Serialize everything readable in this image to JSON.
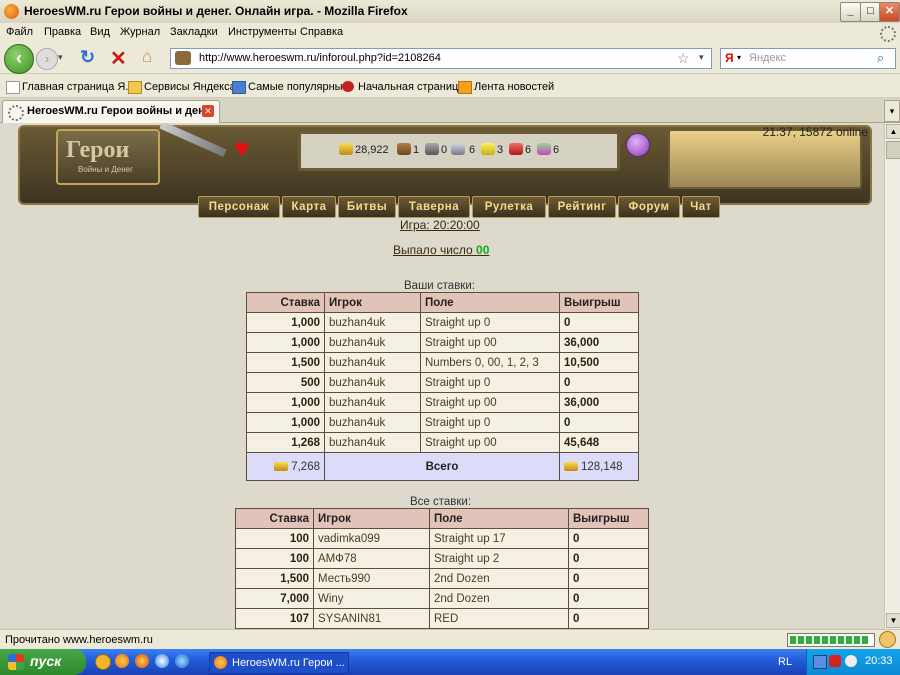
{
  "window": {
    "title": "HeroesWM.ru Герои войны и денег. Онлайн игра. - Mozilla Firefox"
  },
  "menu": [
    "Файл",
    "Правка",
    "Вид",
    "Журнал",
    "Закладки",
    "Инструменты",
    "Справка"
  ],
  "nav": {
    "url": "http://www.heroeswm.ru/inforoul.php?id=2108264",
    "search_engine_label": "Я",
    "search_placeholder": "Яндекс"
  },
  "bookmarks": [
    "Главная страница Я...",
    "Сервисы Яндекса",
    "Самые популярные",
    "Начальная страница",
    "Лента новостей"
  ],
  "tab": {
    "label": "HeroesWM.ru Герои войны и ден..."
  },
  "game": {
    "logo": "Герои",
    "logo_sub": "Войны и Денег",
    "time_online": "21:37, 15872 online",
    "resources": {
      "gold": "28,922",
      "wood": "1",
      "ore": "0",
      "mercury": "6",
      "sulfur": "3",
      "crystals": "6",
      "gems": "6"
    },
    "menu": [
      "Персонаж",
      "Карта",
      "Битвы",
      "Таверна",
      "Рулетка",
      "Рейтинг",
      "Форум",
      "Чат"
    ]
  },
  "roulette": {
    "game_label": "Игра: 20:20:00",
    "result_prefix": "Выпало число ",
    "result_number": "00",
    "your_bets_caption": "Ваши ставки:",
    "all_bets_caption": "Все ставки:",
    "columns": [
      "Ставка",
      "Игрок",
      "Поле",
      "Выигрыш"
    ],
    "your_bets": [
      {
        "bet": "1,000",
        "player": "buzhan4uk",
        "field": "Straight up 0",
        "win": "0"
      },
      {
        "bet": "1,000",
        "player": "buzhan4uk",
        "field": "Straight up 00",
        "win": "36,000"
      },
      {
        "bet": "1,500",
        "player": "buzhan4uk",
        "field": "Numbers 0, 00, 1, 2, 3",
        "win": "10,500"
      },
      {
        "bet": "500",
        "player": "buzhan4uk",
        "field": "Straight up 0",
        "win": "0"
      },
      {
        "bet": "1,000",
        "player": "buzhan4uk",
        "field": "Straight up 00",
        "win": "36,000"
      },
      {
        "bet": "1,000",
        "player": "buzhan4uk",
        "field": "Straight up 0",
        "win": "0"
      },
      {
        "bet": "1,268",
        "player": "buzhan4uk",
        "field": "Straight up 00",
        "win": "45,648"
      }
    ],
    "totals": {
      "bet": "7,268",
      "label": "Всего",
      "win": "128,148"
    },
    "all_bets": [
      {
        "bet": "100",
        "player": "vadimka099",
        "field": "Straight up 17",
        "win": "0"
      },
      {
        "bet": "100",
        "player": "АМФ78",
        "field": "Straight up 2",
        "win": "0"
      },
      {
        "bet": "1,500",
        "player": "Месть990",
        "field": "2nd Dozen",
        "win": "0"
      },
      {
        "bet": "7,000",
        "player": "Winy",
        "field": "2nd Dozen",
        "win": "0"
      },
      {
        "bet": "107",
        "player": "SYSANIN81",
        "field": "RED",
        "win": "0"
      }
    ]
  },
  "status": {
    "text": "Прочитано www.heroeswm.ru"
  },
  "taskbar": {
    "start": "пуск",
    "item": "HeroesWM.ru Герои ...",
    "lang": "RL",
    "clock": "20:33"
  }
}
